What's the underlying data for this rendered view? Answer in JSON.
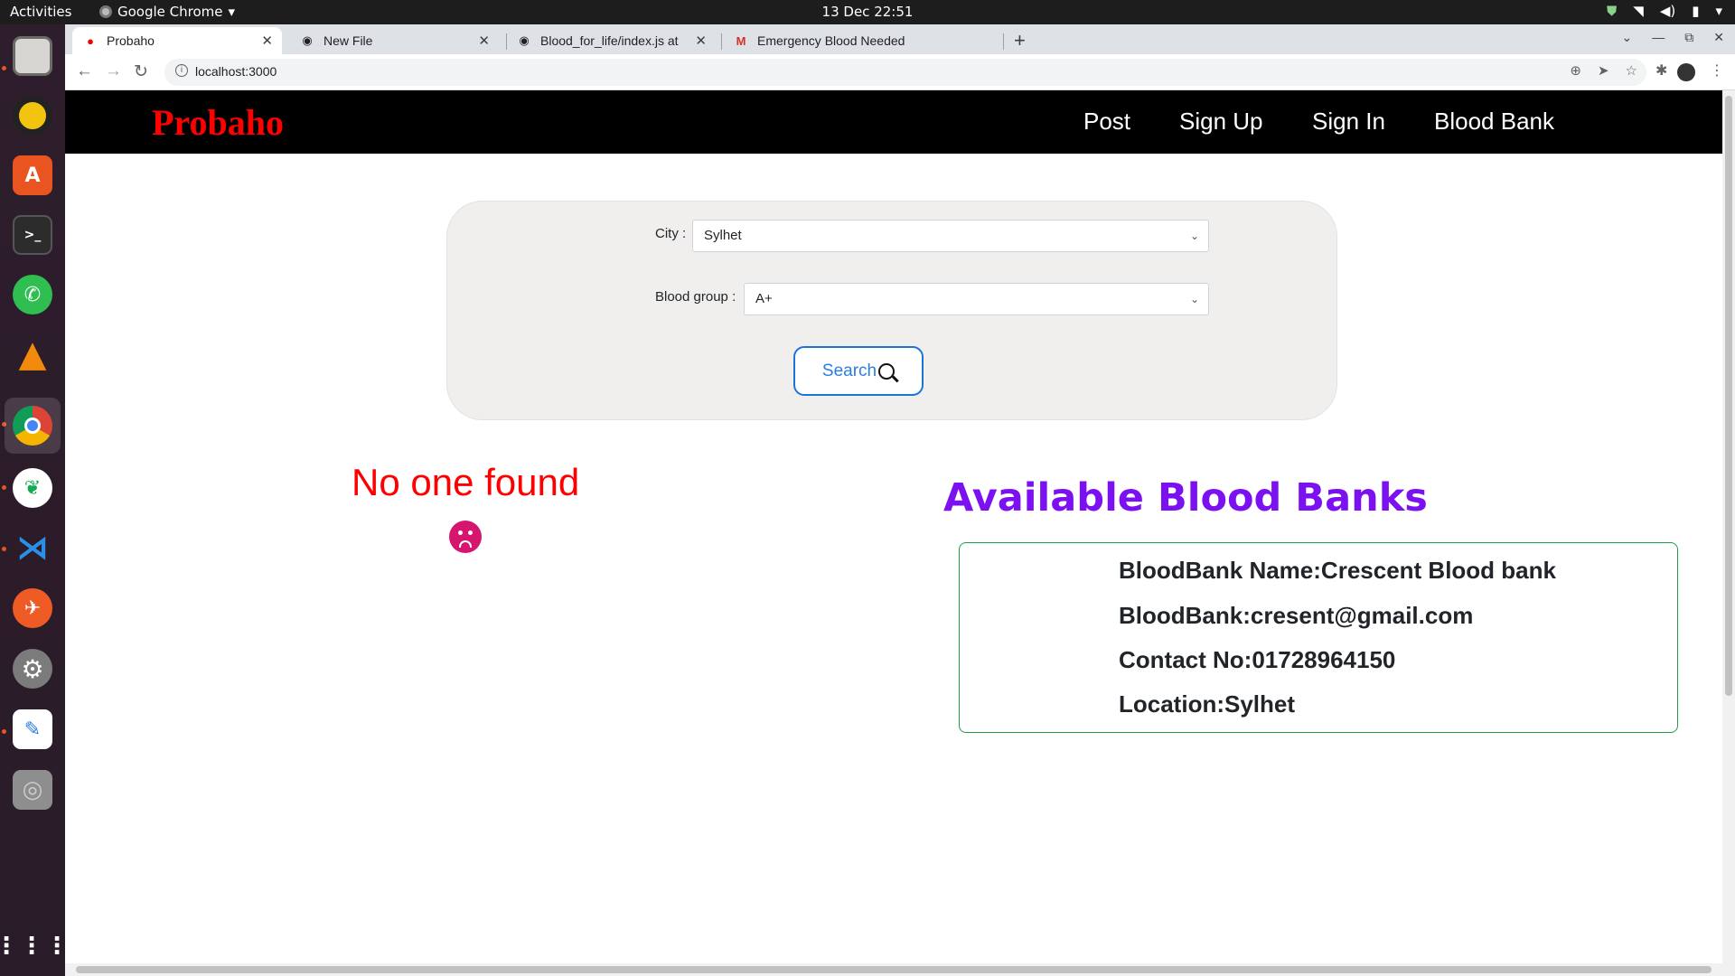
{
  "os": {
    "activities": "Activities",
    "app_name": "Google Chrome",
    "clock": "13 Dec  22:51",
    "dock": [
      "files",
      "rhythmbox",
      "software-center",
      "terminal",
      "whatsapp",
      "vlc",
      "chrome",
      "mongodb-compass",
      "vscode",
      "postman",
      "settings",
      "text-editor",
      "disc-drive",
      "app-grid"
    ]
  },
  "browser": {
    "tabs": [
      {
        "title": "Probaho",
        "favicon": "drop-icon",
        "active": true
      },
      {
        "title": "New File",
        "favicon": "github-icon",
        "active": false
      },
      {
        "title": "Blood_for_life/index.js at",
        "favicon": "github-icon",
        "active": false
      },
      {
        "title": "Emergency Blood Needed",
        "favicon": "gmail-icon",
        "active": false
      }
    ],
    "url": "localhost:3000"
  },
  "site": {
    "brand": "Probaho",
    "nav": [
      "Post",
      "Sign Up",
      "Sign In",
      "Blood Bank"
    ],
    "search": {
      "city_label": "City :",
      "city_value": "Sylhet",
      "blood_group_label": "Blood group :",
      "blood_group_value": "A+",
      "button_label": "Search"
    },
    "no_result_text": "No one found",
    "banks_title": "Available Blood Banks",
    "banks": [
      {
        "name_line": "BloodBank Name:Crescent Blood bank",
        "email_line": "BloodBank:cresent@gmail.com",
        "contact_line": "Contact No:01728964150",
        "location_line": "Location:Sylhet"
      }
    ]
  },
  "colors": {
    "brand": "#ff0000",
    "banks_title": "#7b11f0",
    "card_border": "#1e9c46",
    "search_button": "#1c74d6",
    "sad_face": "#d6156f"
  }
}
